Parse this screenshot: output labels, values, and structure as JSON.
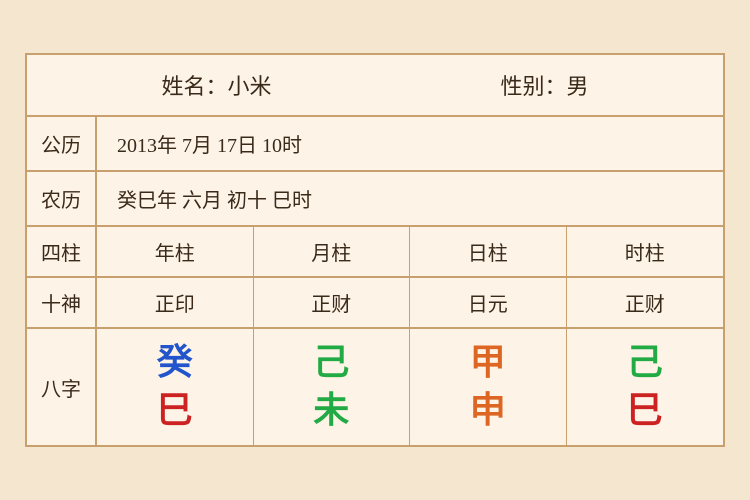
{
  "header": {
    "name_label": "姓名：小米",
    "gender_label": "性别：男"
  },
  "gongli": {
    "label": "公历",
    "value": "2013年 7月 17日 10时"
  },
  "nongli": {
    "label": "农历",
    "value": "癸巳年 六月 初十 巳时"
  },
  "sizhu": {
    "label": "四柱",
    "columns": [
      "年柱",
      "月柱",
      "日柱",
      "时柱"
    ]
  },
  "shishen": {
    "label": "十神",
    "columns": [
      "正印",
      "正财",
      "日元",
      "正财"
    ]
  },
  "bazi": {
    "label": "八字",
    "cells": [
      {
        "top": "癸",
        "top_color": "blue",
        "bottom": "巳",
        "bottom_color": "red"
      },
      {
        "top": "己",
        "top_color": "green",
        "bottom": "未",
        "bottom_color": "green"
      },
      {
        "top": "甲",
        "top_color": "orange",
        "bottom": "申",
        "bottom_color": "orange"
      },
      {
        "top": "己",
        "top_color": "green",
        "bottom": "巳",
        "bottom_color": "red"
      }
    ]
  }
}
